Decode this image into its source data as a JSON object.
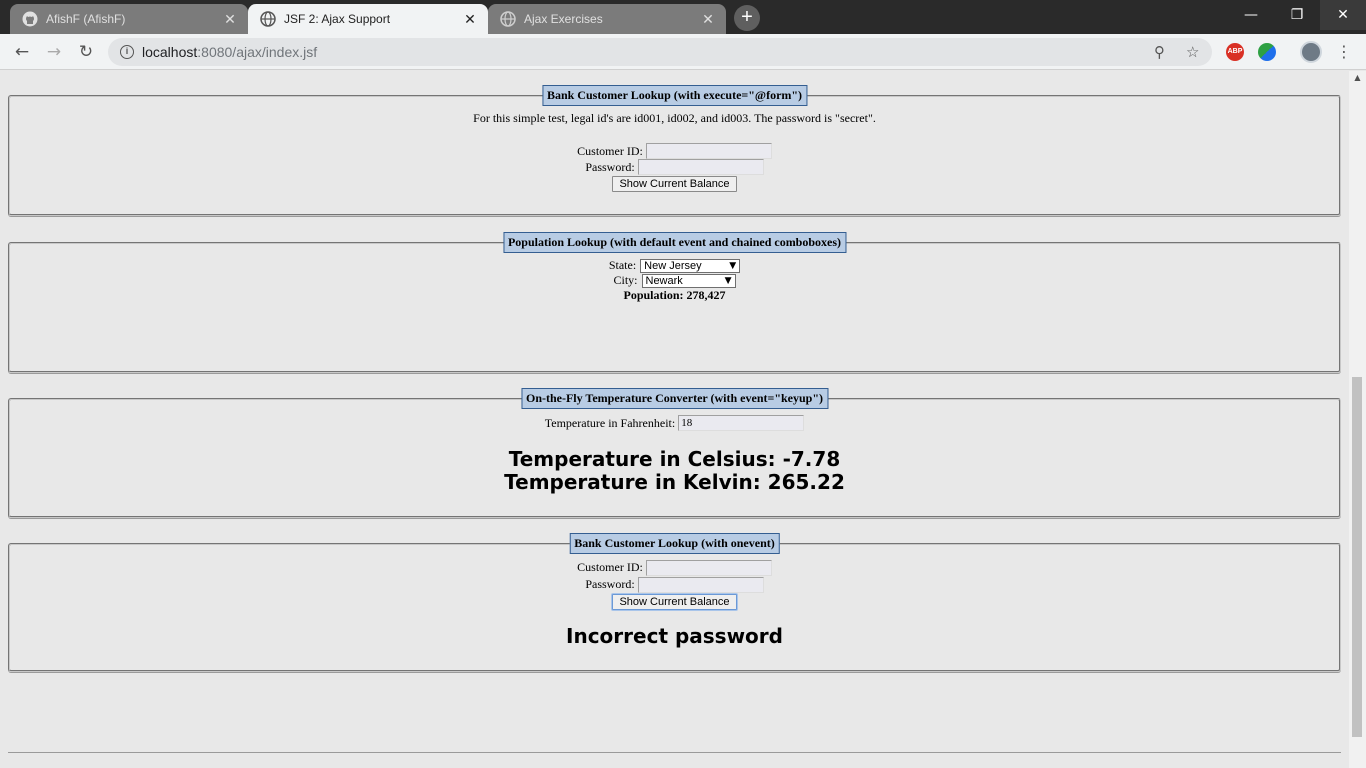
{
  "browser": {
    "tabs": [
      {
        "label": "AfishF (AfishF)",
        "icon": "github-icon",
        "active": false
      },
      {
        "label": "JSF 2: Ajax Support",
        "icon": "globe-icon",
        "active": true
      },
      {
        "label": "Ajax Exercises",
        "icon": "globe-icon",
        "active": false
      }
    ],
    "new_tab": "+",
    "url_host": "localhost",
    "url_path": ":8080/ajax/index.jsf",
    "extensions": {
      "abp_label": "ABP"
    }
  },
  "panels": {
    "bank_form": {
      "legend": "Bank Customer Lookup (with execute=\"@form\")",
      "note": "For this simple test, legal id's are id001, id002, and id003. The password is \"secret\".",
      "customer_id_label": "Customer ID:",
      "customer_id_value": "",
      "password_label": "Password:",
      "password_value": "",
      "button_label": "Show Current Balance"
    },
    "population": {
      "legend": "Population Lookup (with default event and chained comboboxes)",
      "state_label": "State:",
      "state_selected": "New Jersey",
      "city_label": "City:",
      "city_selected": "Newark",
      "result": "Population: 278,427"
    },
    "temperature": {
      "legend": "On-the-Fly Temperature Converter (with event=\"keyup\")",
      "input_label": "Temperature in Fahrenheit:",
      "input_value": "18",
      "celsius": "Temperature in Celsius: -7.78",
      "kelvin": "Temperature in Kelvin: 265.22"
    },
    "bank_onevent": {
      "legend": "Bank Customer Lookup (with onevent)",
      "customer_id_label": "Customer ID:",
      "customer_id_value": "",
      "password_label": "Password:",
      "password_value": "",
      "button_label": "Show Current Balance",
      "result": "Incorrect password"
    }
  }
}
